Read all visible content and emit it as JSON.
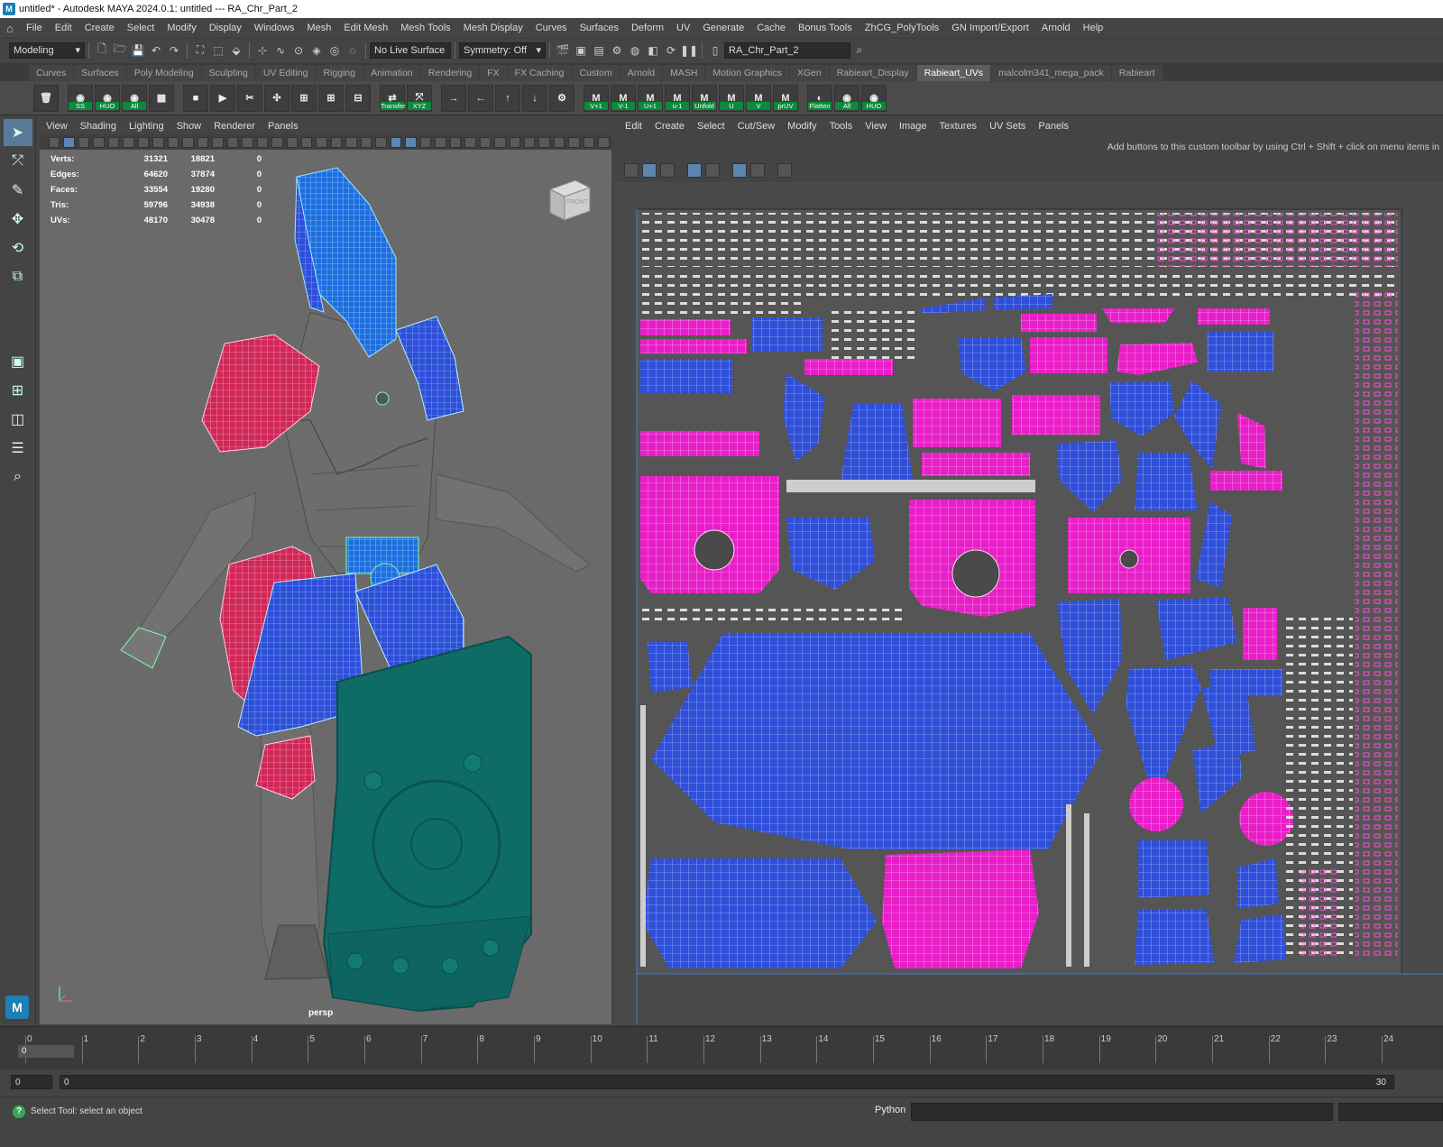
{
  "window": {
    "title": "untitled* - Autodesk MAYA 2024.0.1: untitled   ---   RA_Chr_Part_2",
    "app_icon": "M"
  },
  "menubar": {
    "items": [
      "File",
      "Edit",
      "Create",
      "Select",
      "Modify",
      "Display",
      "Windows",
      "Mesh",
      "Edit Mesh",
      "Mesh Tools",
      "Mesh Display",
      "Curves",
      "Surfaces",
      "Deform",
      "UV",
      "Generate",
      "Cache",
      "Bonus Tools",
      "ZhCG_PolyTools",
      "GN Import/Export",
      "Arnold",
      "Help"
    ]
  },
  "statusline": {
    "workspace": "Modeling",
    "live_surface": "No Live Surface",
    "symmetry": "Symmetry: Off",
    "scene_name": "RA_Chr_Part_2"
  },
  "shelf": {
    "tabs": [
      "Curves",
      "Surfaces",
      "Poly Modeling",
      "Sculpting",
      "UV Editing",
      "Rigging",
      "Animation",
      "Rendering",
      "FX",
      "FX Caching",
      "Custom",
      "Arnold",
      "MASH",
      "Motion Graphics",
      "XGen",
      "Rabieart_Display",
      "Rabieart_UVs",
      "malcolm341_mega_pack",
      "Rabieart"
    ],
    "active_tab": "Rabieart_UVs",
    "buttons": [
      {
        "top": "🗑",
        "label": ""
      },
      {
        "top": "◉",
        "label": "SS"
      },
      {
        "top": "◉",
        "label": "HUO"
      },
      {
        "top": "◉",
        "label": "All"
      },
      {
        "top": "▦",
        "label": ""
      },
      {
        "top": "■",
        "label": ""
      },
      {
        "top": "▶",
        "label": ""
      },
      {
        "top": "✂",
        "label": ""
      },
      {
        "top": "✣",
        "label": ""
      },
      {
        "top": "⊞",
        "label": ""
      },
      {
        "top": "⊞",
        "label": ""
      },
      {
        "top": "⊟",
        "label": ""
      },
      {
        "top": "⇄",
        "label": "Transfer"
      },
      {
        "top": "⤧",
        "label": "XYZ"
      },
      {
        "top": "→",
        "label": ""
      },
      {
        "top": "←",
        "label": ""
      },
      {
        "top": "↑",
        "label": ""
      },
      {
        "top": "↓",
        "label": ""
      },
      {
        "top": "⚙",
        "label": ""
      },
      {
        "top": "M",
        "label": "V+1"
      },
      {
        "top": "M",
        "label": "V-1"
      },
      {
        "top": "M",
        "label": "U+1"
      },
      {
        "top": "M",
        "label": "u-1"
      },
      {
        "top": "M",
        "label": "Unfold"
      },
      {
        "top": "M",
        "label": "U"
      },
      {
        "top": "M",
        "label": "V"
      },
      {
        "top": "M",
        "label": "prUV"
      },
      {
        "top": "◐",
        "label": "Flatten"
      },
      {
        "top": "◉",
        "label": "All"
      },
      {
        "top": "◉",
        "label": "HUO"
      }
    ]
  },
  "viewport": {
    "menu": [
      "View",
      "Shading",
      "Lighting",
      "Show",
      "Renderer",
      "Panels"
    ],
    "hud": [
      {
        "label": "Verts:",
        "a": "31321",
        "b": "18821",
        "c": "0"
      },
      {
        "label": "Edges:",
        "a": "64620",
        "b": "37874",
        "c": "0"
      },
      {
        "label": "Faces:",
        "a": "33554",
        "b": "19280",
        "c": "0"
      },
      {
        "label": "Tris:",
        "a": "59796",
        "b": "34938",
        "c": "0"
      },
      {
        "label": "UVs:",
        "a": "48170",
        "b": "30478",
        "c": "0"
      }
    ],
    "viewcube_label": "FRONT",
    "camera": "persp"
  },
  "uv_editor": {
    "menu": [
      "Edit",
      "Create",
      "Select",
      "Cut/Sew",
      "Modify",
      "Tools",
      "View",
      "Image",
      "Textures",
      "UV Sets",
      "Panels"
    ],
    "hint": "Add buttons to this custom toolbar by using Ctrl + Shift + click on menu items in"
  },
  "timeline": {
    "ticks": [
      "0",
      "1",
      "2",
      "3",
      "4",
      "5",
      "6",
      "7",
      "8",
      "9",
      "10",
      "11",
      "12",
      "13",
      "14",
      "15",
      "16",
      "17",
      "18",
      "19",
      "20",
      "21",
      "22",
      "23",
      "24"
    ],
    "current_frame": "0"
  },
  "range": {
    "start": "0",
    "playback_start": "0",
    "end": "30"
  },
  "helpline": {
    "text": "Select Tool: select an object",
    "python_label": "Python"
  },
  "colors": {
    "mesh_gray": "#6f6f6f",
    "uv_blue": "#2f4fd8",
    "uv_magenta": "#e81ec8",
    "shield_teal": "#0f6b66",
    "wire_green": "#7dffb0",
    "wire_white": "#ffffff"
  }
}
